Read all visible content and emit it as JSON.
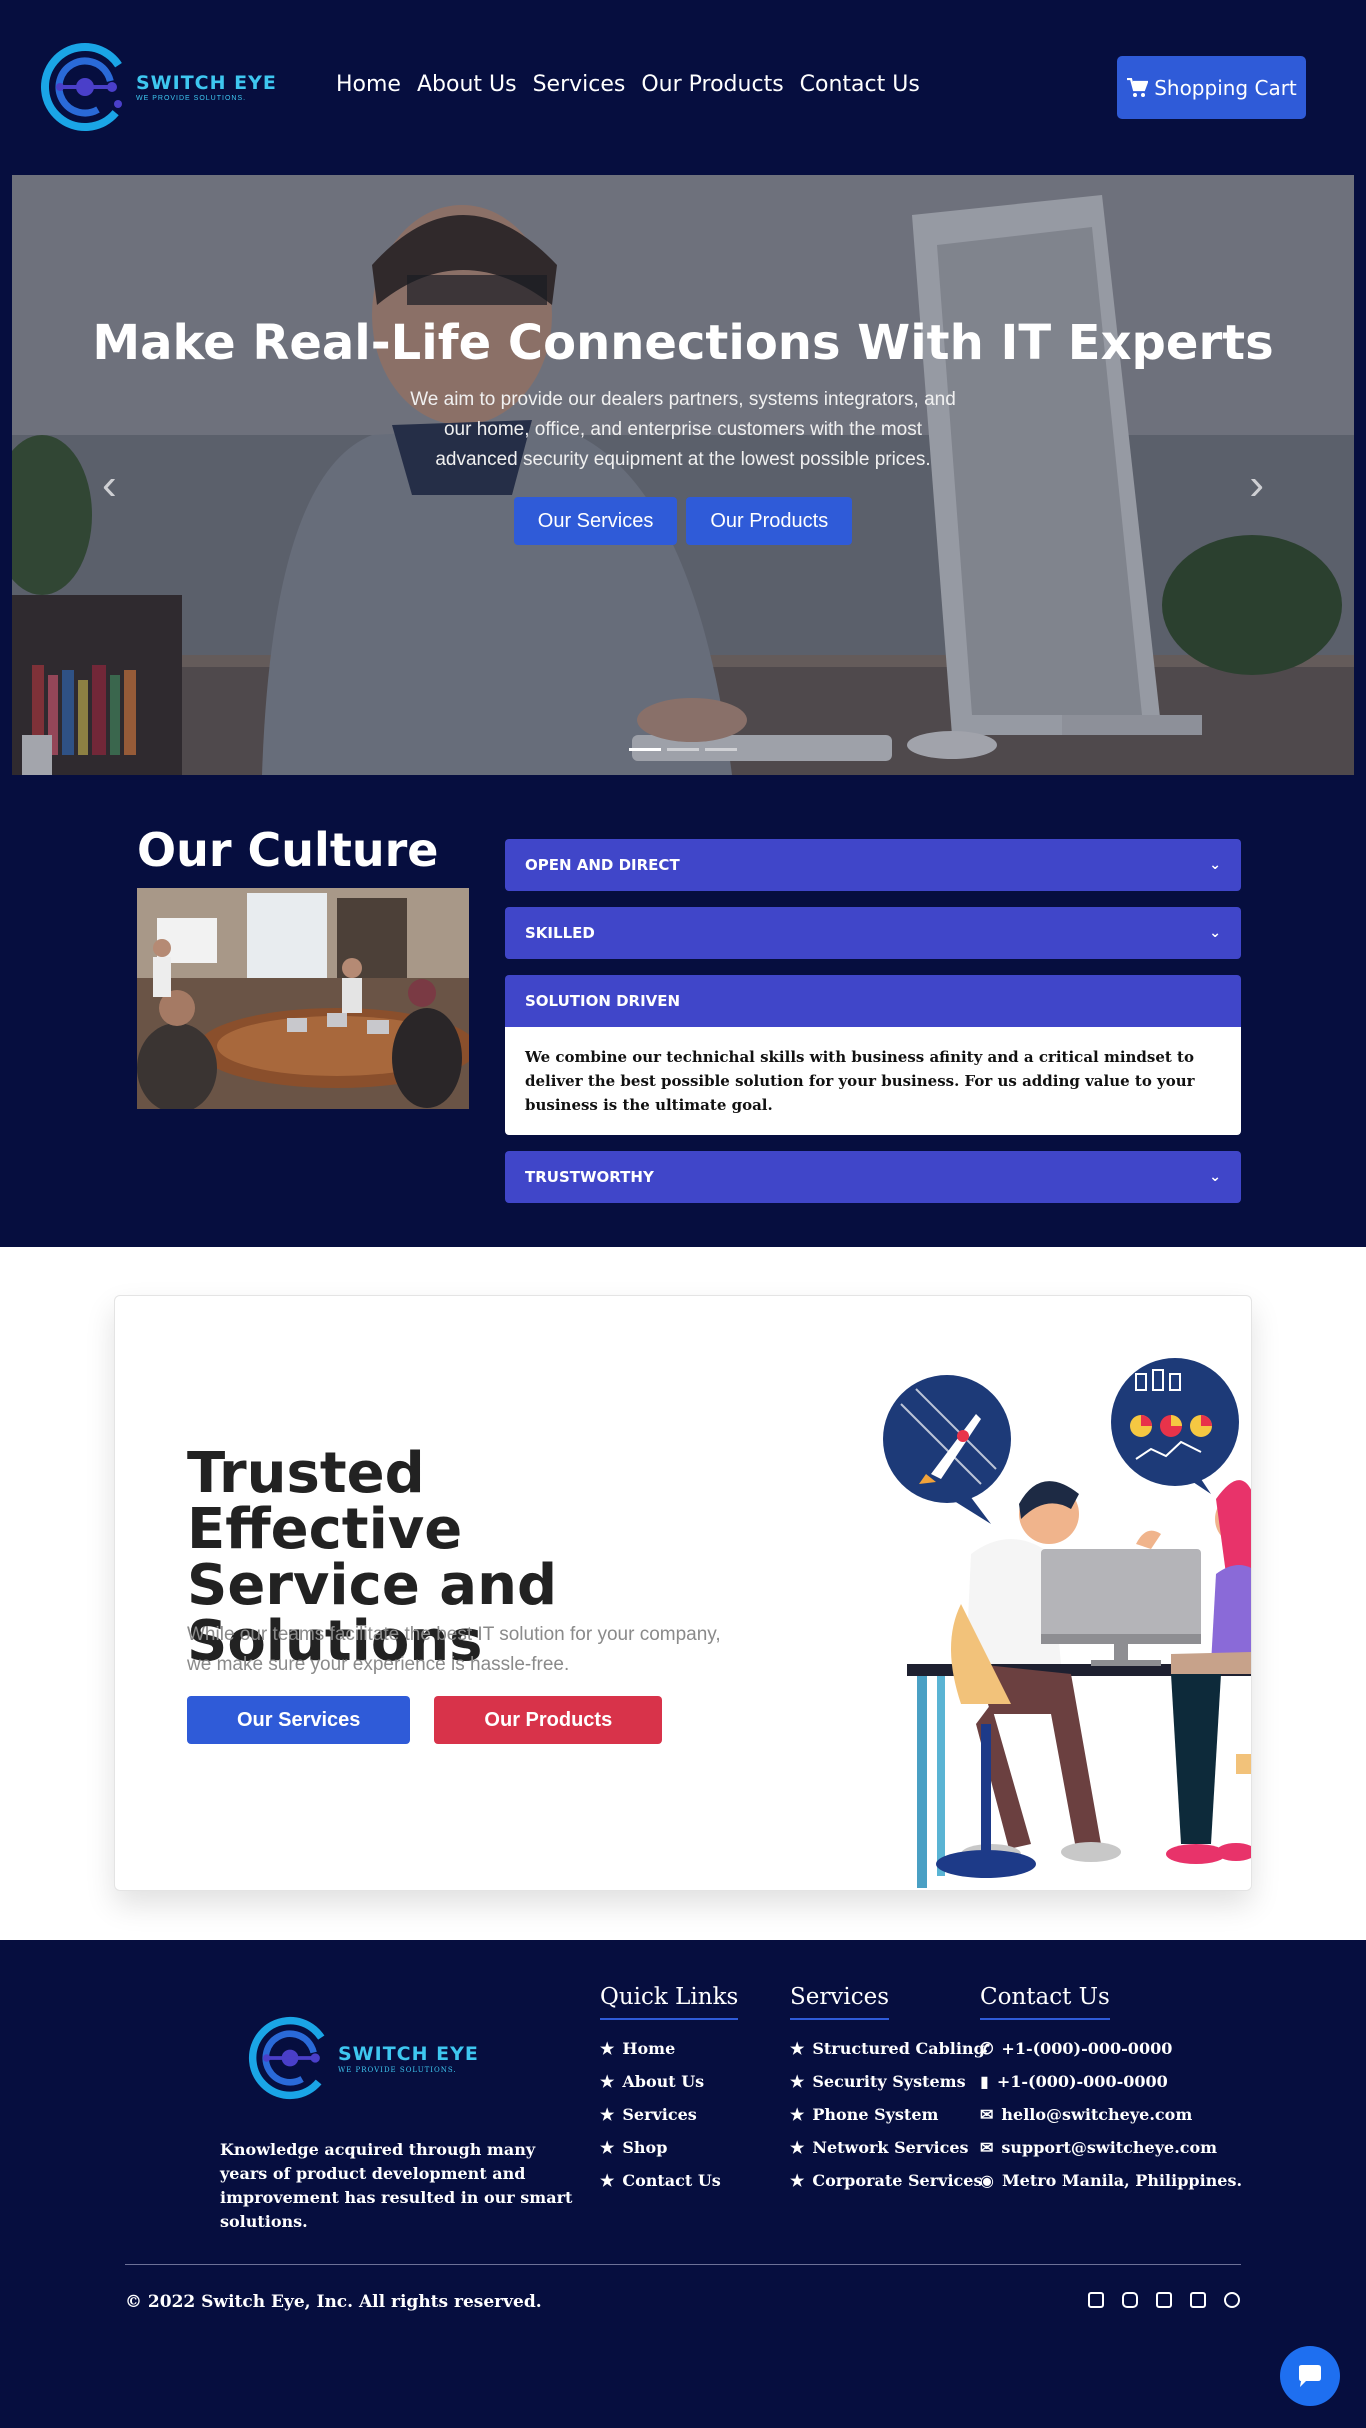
{
  "brand": {
    "name": "SWITCH EYE",
    "tagline": "WE PROVIDE SOLUTIONS.",
    "accent": "#3ec7f0"
  },
  "nav": {
    "items": [
      {
        "label": "Home"
      },
      {
        "label": "About Us"
      },
      {
        "label": "Services"
      },
      {
        "label": "Our Products"
      },
      {
        "label": "Contact Us"
      }
    ],
    "cart_label": "Shopping Cart",
    "cart_icon": "cart-icon"
  },
  "hero": {
    "title": "Make Real-Life Connections With IT Experts",
    "subtitle": "We aim to provide our dealers partners, systems integrators, and our home, office, and enterprise customers with the most advanced security equipment at the lowest possible prices.",
    "buttons": [
      {
        "label": "Our Services"
      },
      {
        "label": "Our Products"
      }
    ],
    "prev_icon": "chevron-left-icon",
    "next_icon": "chevron-right-icon",
    "slide_count": 3,
    "active_slide": 1
  },
  "culture": {
    "title": "Our Culture",
    "items": [
      {
        "label": "OPEN AND DIRECT",
        "open": false
      },
      {
        "label": "SKILLED",
        "open": false
      },
      {
        "label": "SOLUTION DRIVEN",
        "open": true,
        "body": "We combine our technichal skills with business afinity and a critical mindset to deliver the best possible solution for your business. For us adding value to your business is the ultimate goal."
      },
      {
        "label": "TRUSTWORTHY",
        "open": false
      }
    ]
  },
  "trusted": {
    "title": "Trusted Effective Service and Solutions",
    "text": "While our teams facilitate the best IT solution for your company, we make sure your experience is hassle-free.",
    "primary": "Our Services",
    "secondary": "Our Products",
    "primary_color": "#2f5bd8",
    "secondary_color": "#d8334a"
  },
  "footer": {
    "about": "Knowledge acquired through many years of product development and improvement has resulted in our smart solutions.",
    "quick_links": {
      "title": "Quick Links",
      "items": [
        "Home",
        "About Us",
        "Services",
        "Shop",
        "Contact Us"
      ]
    },
    "services": {
      "title": "Services",
      "items": [
        "Structured Cabling",
        "Security Systems",
        "Phone System",
        "Network Services",
        "Corporate Services"
      ]
    },
    "contact": {
      "title": "Contact Us",
      "items": [
        {
          "icon": "phone-icon",
          "text": "+1-(000)-000-0000"
        },
        {
          "icon": "mobile-icon",
          "text": "+1-(000)-000-0000"
        },
        {
          "icon": "envelope-icon",
          "text": "hello@switcheye.com"
        },
        {
          "icon": "envelope-icon",
          "text": "support@switcheye.com"
        },
        {
          "icon": "map-pin-icon",
          "text": "Metro Manila, Philippines."
        }
      ]
    },
    "copyright": "© 2022 Switch Eye, Inc. All rights reserved.",
    "social": [
      "facebook-icon",
      "instagram-icon",
      "twitter-icon",
      "google-plus-icon",
      "pinterest-icon"
    ],
    "chat_icon": "chat-icon"
  }
}
